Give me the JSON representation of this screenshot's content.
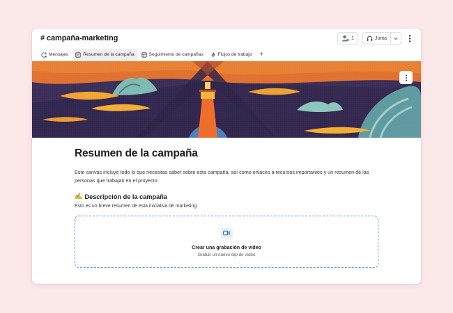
{
  "header": {
    "channel_title": "# campaña-marketing",
    "member_count": "1",
    "huddle_label": "Junta"
  },
  "tabs": [
    {
      "label": "Mensajes",
      "icon": "message-icon"
    },
    {
      "label": "Resumen de la campaña",
      "icon": "canvas-icon",
      "active": true
    },
    {
      "label": "Seguimiento de campañas",
      "icon": "list-icon"
    },
    {
      "label": "Flujos de trabajo",
      "icon": "lightning-icon"
    }
  ],
  "add_tab_label": "+",
  "colors": {
    "background": "#fbe9ea",
    "accent_blue": "#1264a3",
    "banner_orange": "#e86a2b",
    "banner_purple": "#3b2e5a"
  },
  "canvas": {
    "title": "Resumen de la campaña",
    "intro": "Este canvas incluye todo lo que necesitas saber sobre esta campaña, así como enlaces a recursos importantes y un resumen de las personas que trabajan en el proyecto.",
    "section_emoji": "✍️",
    "section_heading": "Descripción de la campaña",
    "section_desc": "Esto es un breve resumen de esta iniciativa de marketing.",
    "video_title": "Crear una grabación de vídeo",
    "video_sub": "Grabar un nuevo clip de vídeo"
  }
}
